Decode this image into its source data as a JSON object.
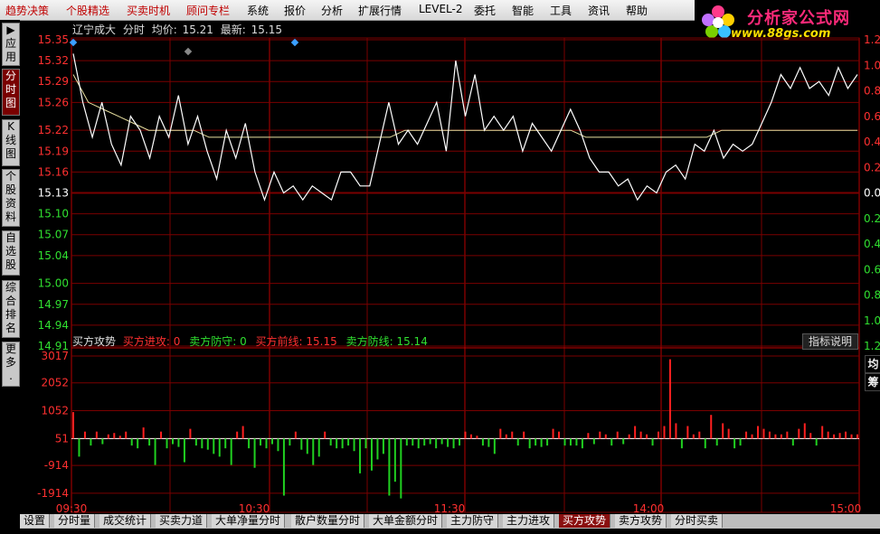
{
  "menu": [
    {
      "label": "趋势决策",
      "red": true
    },
    {
      "label": "个股精选",
      "red": true
    },
    {
      "label": "买卖时机",
      "red": true
    },
    {
      "label": "顾问专栏",
      "red": true
    },
    {
      "label": "系统",
      "red": false
    },
    {
      "label": "报价",
      "red": false
    },
    {
      "label": "分析",
      "red": false
    },
    {
      "label": "扩展行情",
      "red": false
    },
    {
      "label": "LEVEL-2",
      "red": false
    },
    {
      "label": "委托",
      "red": false
    },
    {
      "label": "智能",
      "red": false
    },
    {
      "label": "工具",
      "red": false
    },
    {
      "label": "资讯",
      "red": false
    },
    {
      "label": "帮助",
      "red": false
    }
  ],
  "logo": {
    "name": "分析家公式网",
    "url": "www.88gs.com"
  },
  "left_tabs": [
    {
      "label": "应用",
      "icon": "▶",
      "active": false
    },
    {
      "label": "分时图",
      "icon": "",
      "active": true
    },
    {
      "label": "K线图",
      "icon": "",
      "active": false
    },
    {
      "label": "个股资料",
      "icon": "",
      "active": false
    },
    {
      "label": "自选股",
      "icon": "",
      "active": false
    },
    {
      "label": "综合排名",
      "icon": "",
      "active": false
    },
    {
      "label": "更多..",
      "icon": "",
      "active": false
    }
  ],
  "header": {
    "stock": "辽宁成大",
    "view": "分时",
    "avg_label": "均价:",
    "avg": "15.21",
    "last_label": "最新:",
    "last": "15.15"
  },
  "indicator": {
    "name": "买方攻势",
    "items": [
      {
        "label": "买方进攻:",
        "value": "0",
        "color": "#ff3030"
      },
      {
        "label": "卖方防守:",
        "value": "0",
        "color": "#30e030"
      },
      {
        "label": "买方前线:",
        "value": "15.15",
        "color": "#ff3030"
      },
      {
        "label": "卖方防线:",
        "value": "15.14",
        "color": "#30e030"
      }
    ],
    "help_button": "指标说明"
  },
  "right_boxes": [
    "均",
    "筹"
  ],
  "bottom_tabs": [
    {
      "label": "设置",
      "active": false
    },
    {
      "label": "分时量",
      "active": false
    },
    {
      "label": "成交统计",
      "active": false
    },
    {
      "label": "买卖力道",
      "active": false
    },
    {
      "label": "大单净量分时",
      "active": false
    },
    {
      "label": "散户数量分时",
      "active": false
    },
    {
      "label": "大单金额分时",
      "active": false
    },
    {
      "label": "主力防守",
      "active": false
    },
    {
      "label": "主力进攻",
      "active": false
    },
    {
      "label": "买方攻势",
      "active": true
    },
    {
      "label": "卖方攻势",
      "active": false
    },
    {
      "label": "分时买卖",
      "active": false
    }
  ],
  "colors": {
    "up": "#ff2020",
    "down": "#20d020",
    "grid": "#7a0000",
    "price": "#ffffff",
    "avg": "#e8e0a0",
    "axis_text": "#ff3030"
  },
  "chart_data": [
    {
      "type": "line",
      "title": "辽宁成大 分时",
      "y_ticks_left": [
        "15.35",
        "15.32",
        "15.29",
        "15.26",
        "15.22",
        "15.19",
        "15.16",
        "15.13",
        "15.10",
        "15.07",
        "15.04",
        "15.00",
        "14.97",
        "14.94",
        "14.91"
      ],
      "y_ticks_right": [
        "1.2",
        "1.0",
        "0.8",
        "0.6",
        "0.4",
        "0.2",
        "0.00",
        "0.2",
        "0.4",
        "0.6",
        "0.8",
        "1.0",
        "1.2"
      ],
      "prev_close": 15.13,
      "ylim": [
        14.91,
        15.35
      ],
      "x_ticks": [
        "09:30",
        "10:30",
        "11:30",
        "14:00",
        "15:00"
      ],
      "series": [
        {
          "kind": "price",
          "values": [
            15.33,
            15.26,
            15.21,
            15.26,
            15.2,
            15.17,
            15.24,
            15.22,
            15.18,
            15.24,
            15.21,
            15.27,
            15.2,
            15.24,
            15.19,
            15.15,
            15.22,
            15.18,
            15.23,
            15.16,
            15.12,
            15.16,
            15.13,
            15.14,
            15.12,
            15.14,
            15.13,
            15.12,
            15.16,
            15.16,
            15.14,
            15.14,
            15.2,
            15.26,
            15.2,
            15.22,
            15.2,
            15.23,
            15.26,
            15.19,
            15.32,
            15.24,
            15.3,
            15.22,
            15.24,
            15.22,
            15.24,
            15.19,
            15.23,
            15.21,
            15.19,
            15.22,
            15.25,
            15.22,
            15.18,
            15.16,
            15.16,
            15.14,
            15.15,
            15.12,
            15.14,
            15.13,
            15.16,
            15.17,
            15.15,
            15.2,
            15.19,
            15.22,
            15.18,
            15.2,
            15.19,
            15.2,
            15.23,
            15.26,
            15.3,
            15.28,
            15.31,
            15.28,
            15.29,
            15.27,
            15.31,
            15.28,
            15.3
          ]
        },
        {
          "kind": "average",
          "values": [
            15.3,
            15.26,
            15.25,
            15.24,
            15.23,
            15.22,
            15.22,
            15.22,
            15.22,
            15.21,
            15.21,
            15.21,
            15.21,
            15.21,
            15.21,
            15.21,
            15.21,
            15.21,
            15.21,
            15.21,
            15.21,
            15.21,
            15.22,
            15.22,
            15.22,
            15.22,
            15.22,
            15.22,
            15.22,
            15.22,
            15.22,
            15.22,
            15.22,
            15.22,
            15.21,
            15.21,
            15.21,
            15.21,
            15.21,
            15.21,
            15.21,
            15.21,
            15.21,
            15.22,
            15.22,
            15.22,
            15.22,
            15.22,
            15.22,
            15.22,
            15.22,
            15.22,
            15.22
          ]
        }
      ]
    },
    {
      "type": "bar",
      "title": "买方攻势",
      "y_ticks": [
        "3017",
        "2052",
        "1052",
        "51",
        "-914",
        "-1914"
      ],
      "ylim": [
        -2600,
        3017
      ],
      "values": [
        1000,
        -600,
        300,
        -200,
        300,
        -150,
        200,
        250,
        150,
        300,
        -200,
        -300,
        450,
        -200,
        -900,
        300,
        -300,
        -150,
        -250,
        -800,
        400,
        -200,
        -300,
        -350,
        -500,
        -600,
        -300,
        -900,
        300,
        500,
        -300,
        -1000,
        -200,
        -300,
        -150,
        -400,
        -2000,
        -200,
        300,
        -350,
        -500,
        -900,
        -600,
        300,
        -200,
        -300,
        -300,
        -200,
        -400,
        -1200,
        -300,
        -1100,
        -700,
        -500,
        -2000,
        -1500,
        -2100,
        -200,
        -200,
        -300,
        -200,
        -150,
        -300,
        -150,
        -250,
        -300,
        -200,
        300,
        200,
        150,
        -200,
        -250,
        -500,
        400,
        200,
        300,
        -200,
        300,
        -300,
        -200,
        -250,
        -200,
        400,
        300,
        -200,
        -200,
        -200,
        -300,
        250,
        -150,
        300,
        200,
        -200,
        300,
        -150,
        200,
        500,
        300,
        200,
        -200,
        300,
        500,
        2900,
        600,
        -300,
        500,
        200,
        300,
        -300,
        900,
        -200,
        600,
        400,
        -300,
        -200,
        300,
        200,
        500,
        400,
        300,
        200,
        200,
        300,
        -200,
        400,
        600,
        250,
        -200,
        500,
        300,
        200,
        250,
        300,
        200,
        200
      ]
    }
  ]
}
